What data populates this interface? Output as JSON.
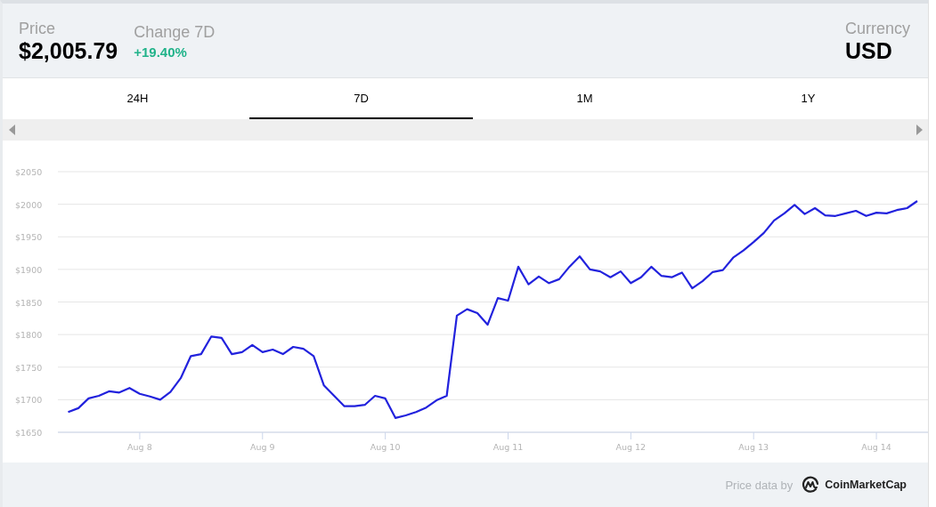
{
  "header": {
    "price_label": "Price",
    "price": "$2,005.79",
    "change_label": "Change 7D",
    "change": "+19.40%",
    "currency_label": "Currency",
    "currency": "USD"
  },
  "tabs": [
    {
      "label": "24H",
      "selected": false
    },
    {
      "label": "7D",
      "selected": true
    },
    {
      "label": "1M",
      "selected": false
    },
    {
      "label": "1Y",
      "selected": false
    }
  ],
  "chart": {
    "chart_data": {
      "type": "line",
      "grid": true,
      "ylim": [
        1650,
        2050
      ],
      "yticks": [
        {
          "value": 1650,
          "label": "$1650"
        },
        {
          "value": 1700,
          "label": "$1700"
        },
        {
          "value": 1750,
          "label": "$1750"
        },
        {
          "value": 1800,
          "label": "$1800"
        },
        {
          "value": 1850,
          "label": "$1850"
        },
        {
          "value": 1900,
          "label": "$1900"
        },
        {
          "value": 1950,
          "label": "$1950"
        },
        {
          "value": 2000,
          "label": "$2000"
        },
        {
          "value": 2050,
          "label": "$2050"
        }
      ],
      "categories": [
        null,
        null,
        null,
        null,
        null,
        null,
        null,
        "Aug 8",
        null,
        null,
        null,
        null,
        null,
        null,
        null,
        null,
        null,
        null,
        null,
        "Aug 9",
        null,
        null,
        null,
        null,
        null,
        null,
        null,
        null,
        null,
        null,
        null,
        "Aug 10",
        null,
        null,
        null,
        null,
        null,
        null,
        null,
        null,
        null,
        null,
        null,
        "Aug 11",
        null,
        null,
        null,
        null,
        null,
        null,
        null,
        null,
        null,
        null,
        null,
        "Aug 12",
        null,
        null,
        null,
        null,
        null,
        null,
        null,
        null,
        null,
        null,
        null,
        "Aug 13",
        null,
        null,
        null,
        null,
        null,
        null,
        null,
        null,
        null,
        null,
        null,
        "Aug 14",
        null,
        null,
        null,
        null
      ],
      "series": [
        {
          "color": "#2222dd",
          "values": [
            1681,
            1687,
            1702,
            1706,
            1713,
            1711,
            1718,
            1709,
            1705,
            1700,
            1712,
            1733,
            1767,
            1770,
            1797,
            1795,
            1770,
            1773,
            1784,
            1773,
            1777,
            1770,
            1781,
            1778,
            1767,
            1722,
            1706,
            1690,
            1690,
            1692,
            1706,
            1702,
            1672,
            1676,
            1681,
            1688,
            1699,
            1706,
            1829,
            1839,
            1833,
            1815,
            1856,
            1852,
            1904,
            1877,
            1889,
            1879,
            1885,
            1904,
            1920,
            1900,
            1897,
            1888,
            1897,
            1879,
            1888,
            1904,
            1890,
            1888,
            1895,
            1871,
            1882,
            1896,
            1899,
            1918,
            1929,
            1942,
            1956,
            1975,
            1986,
            1999,
            1985,
            1994,
            1983,
            1982,
            1986,
            1990,
            1982,
            1987,
            1986,
            1991,
            1994,
            2005
          ]
        }
      ]
    }
  },
  "footer": {
    "credit": "Price data by",
    "brand": "CoinMarketCap"
  }
}
